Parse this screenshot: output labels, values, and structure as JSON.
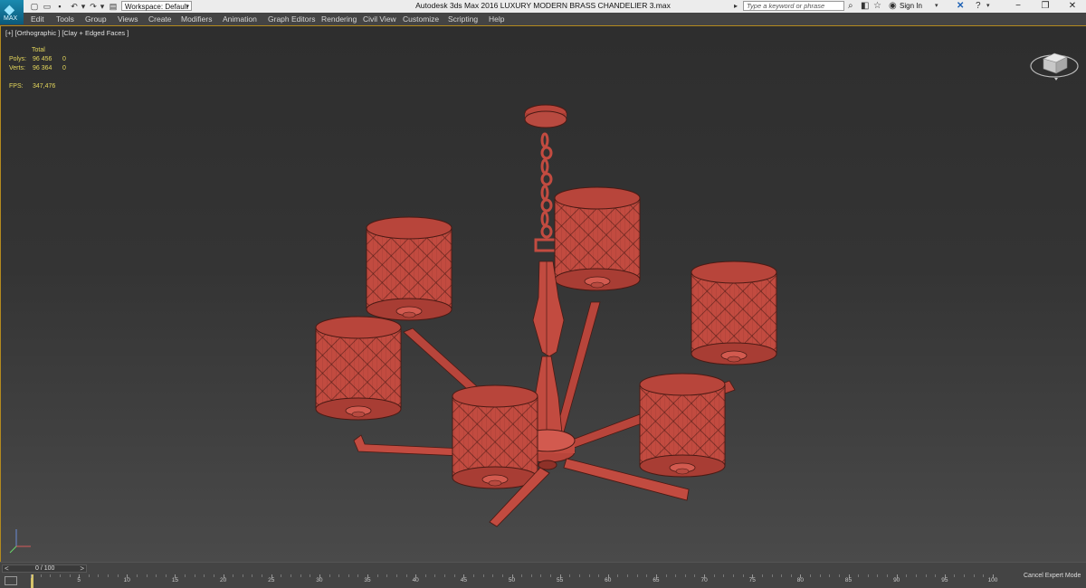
{
  "app": {
    "logo_glyph": "◆",
    "logo_text": "MAX",
    "workspace_label": "Workspace: Default",
    "title": "Autodesk 3ds Max 2016      LUXURY MODERN BRASS CHANDELIER 3.max",
    "search_placeholder": "Type a keyword or phrase",
    "signin_label": "Sign In"
  },
  "menu": [
    "Edit",
    "Tools",
    "Group",
    "Views",
    "Create",
    "Modifiers",
    "Animation",
    "Graph Editors",
    "Rendering",
    "Civil View",
    "Customize",
    "Scripting",
    "Help"
  ],
  "viewport": {
    "label": "[+] [Orthographic ] [Clay + Edged Faces ]",
    "stats": {
      "total_label": "Total",
      "polys_label": "Polys:",
      "polys_value": "96 456",
      "polys_sel": "0",
      "verts_label": "Verts:",
      "verts_value": "96 364",
      "verts_sel": "0",
      "fps_label": "FPS:",
      "fps_value": "347,476"
    },
    "model_color": "#c24b40",
    "background_color": "#343434"
  },
  "timeline": {
    "frame_display": "0 / 100",
    "prev_glyph": "<",
    "next_glyph": ">",
    "cancel_label": "Cancel Expert Mode",
    "current_frame": 0,
    "ticks": [
      "0",
      "5",
      "10",
      "15",
      "20",
      "25",
      "30",
      "35",
      "40",
      "45",
      "50",
      "55",
      "60",
      "65",
      "70",
      "75",
      "80",
      "85",
      "90",
      "95",
      "100"
    ]
  },
  "icons": {
    "new": "new-file-icon",
    "open": "open-folder-icon",
    "save": "save-icon",
    "undo": "undo-icon",
    "redo": "redo-icon"
  }
}
